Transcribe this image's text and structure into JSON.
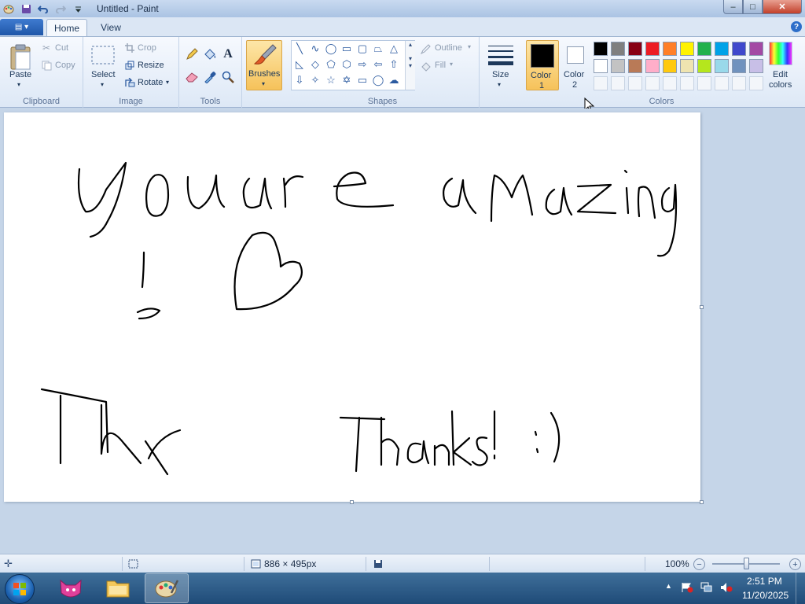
{
  "window": {
    "title": "Untitled - Paint",
    "controls": {
      "minimize": "–",
      "maximize": "□",
      "close": "✕"
    }
  },
  "tabs": {
    "file": "▤ ▾",
    "home": "Home",
    "view": "View",
    "help": "?"
  },
  "ribbon": {
    "clipboard": {
      "label": "Clipboard",
      "paste": "Paste",
      "cut": "Cut",
      "copy": "Copy"
    },
    "image": {
      "label": "Image",
      "select": "Select",
      "crop": "Crop",
      "resize": "Resize",
      "rotate": "Rotate"
    },
    "tools": {
      "label": "Tools"
    },
    "brushes": {
      "label": "Brushes"
    },
    "shapes": {
      "label": "Shapes",
      "outline": "Outline",
      "fill": "Fill"
    },
    "size": {
      "label": "Size"
    },
    "colors": {
      "label": "Colors",
      "color1_line1": "Color",
      "color1_line2": "1",
      "color2_line1": "Color",
      "color2_line2": "2",
      "edit_line1": "Edit",
      "edit_line2": "colors",
      "color1": "#000000",
      "color2": "#ffffff",
      "palette_row1": [
        "#000000",
        "#7f7f7f",
        "#880015",
        "#ed1c24",
        "#ff7f27",
        "#fff200",
        "#22b14c",
        "#00a2e8",
        "#3f48cc",
        "#a349a4"
      ],
      "palette_row2": [
        "#ffffff",
        "#c3c3c3",
        "#b97a57",
        "#ffaec9",
        "#ffc90e",
        "#efe4b0",
        "#b5e61d",
        "#99d9ea",
        "#7092be",
        "#c8bfe7"
      ]
    }
  },
  "canvas": {
    "drawn_text": {
      "line1": "you are amazing",
      "line2": "! ♡",
      "left_word": "Thx",
      "right_text": "Thanks! :)"
    }
  },
  "statusbar": {
    "dimensions": "886 × 495px",
    "zoom": "100%"
  },
  "taskbar": {
    "time": "2:51 PM",
    "date": "11/20/2025"
  }
}
